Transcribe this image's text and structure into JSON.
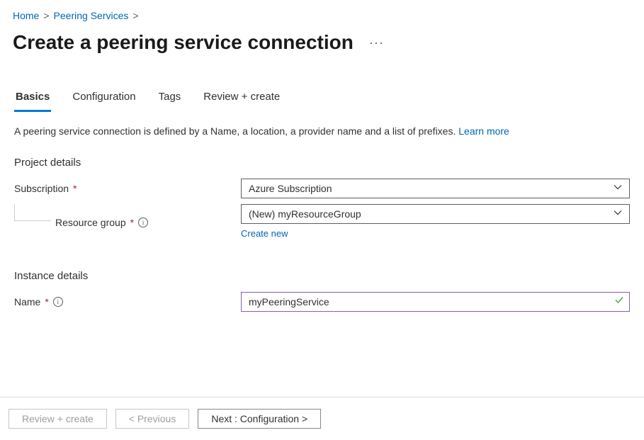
{
  "breadcrumb": {
    "home": "Home",
    "peering_services": "Peering Services",
    "sep": ">"
  },
  "page": {
    "title": "Create a peering service connection"
  },
  "tabs": {
    "basics": "Basics",
    "configuration": "Configuration",
    "tags": "Tags",
    "review_create": "Review + create"
  },
  "description": {
    "text": "A peering service connection is defined by a Name, a location, a provider name and a list of prefixes. ",
    "learn_more": "Learn more"
  },
  "sections": {
    "project_details": "Project details",
    "instance_details": "Instance details"
  },
  "fields": {
    "subscription": {
      "label": "Subscription",
      "value": "Azure Subscription"
    },
    "resource_group": {
      "label": "Resource group",
      "value": "(New) myResourceGroup",
      "create_new": "Create new"
    },
    "name": {
      "label": "Name",
      "value": "myPeeringService"
    }
  },
  "footer": {
    "review_create": "Review + create",
    "previous": "< Previous",
    "next": "Next : Configuration >"
  }
}
